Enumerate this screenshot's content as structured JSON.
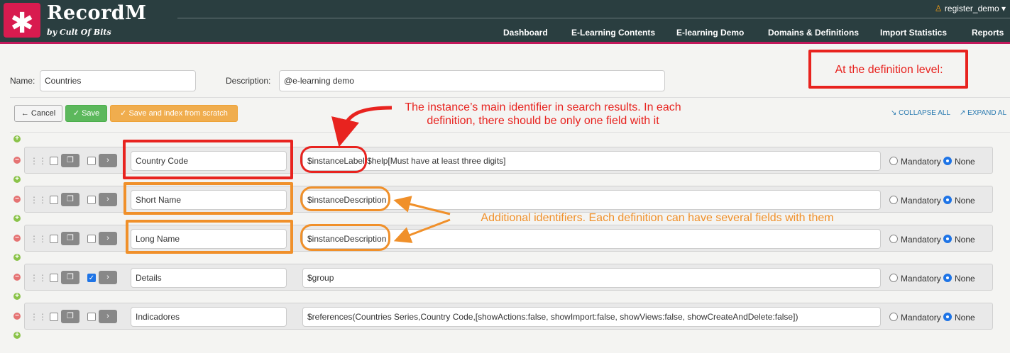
{
  "app": {
    "title": "RecordM",
    "subtitle": "by Cult Of Bits",
    "logo_glyph": "✱",
    "user": "register_demo",
    "nav": [
      "Dashboard",
      "E-Learning Contents",
      "E-learning Demo",
      "Domains & Definitions",
      "Import Statistics",
      "Reports"
    ]
  },
  "form": {
    "name_label": "Name:",
    "name_value": "Countries",
    "description_label": "Description:",
    "description_value": "@e-learning demo"
  },
  "toolbar": {
    "cancel_label": "Cancel",
    "save_label": "Save",
    "index_label": "Save and index from scratch",
    "collapse_all": "COLLAPSE ALL",
    "expand_all": "EXPAND AL"
  },
  "fields": [
    {
      "name": "Country Code",
      "description": "$instanceLabel $help[Must have at least three digits]",
      "dup_checked": false,
      "mandatory": "Mandatory",
      "none": "None"
    },
    {
      "name": "Short Name",
      "description": "$instanceDescription",
      "dup_checked": false,
      "mandatory": "Mandatory",
      "none": "None"
    },
    {
      "name": "Long Name",
      "description": "$instanceDescription",
      "dup_checked": false,
      "mandatory": "Mandatory",
      "none": "None"
    },
    {
      "name": "Details",
      "description": "$group",
      "dup_checked": true,
      "mandatory": "Mandatory",
      "none": "None"
    },
    {
      "name": "Indicadores",
      "description": "$references(Countries Series,Country Code,[showActions:false, showImport:false, showViews:false, showCreateAndDelete:false])",
      "dup_checked": false,
      "mandatory": "Mandatory",
      "none": "None"
    }
  ],
  "annotations": {
    "definition_level": "At the definition level:",
    "main_identifier": "The instance’s main identifier in search results. In each definition, there should be only one field with it",
    "additional_identifiers": "Additional identifiers. Each definition can have several fields with them"
  },
  "colors": {
    "header_bg": "#2a3e40",
    "brand_accent": "#d81b4f",
    "annotation_red": "#e8231f",
    "annotation_orange": "#f0902a",
    "save_green": "#5cb85c",
    "index_orange": "#f0ad4e"
  }
}
